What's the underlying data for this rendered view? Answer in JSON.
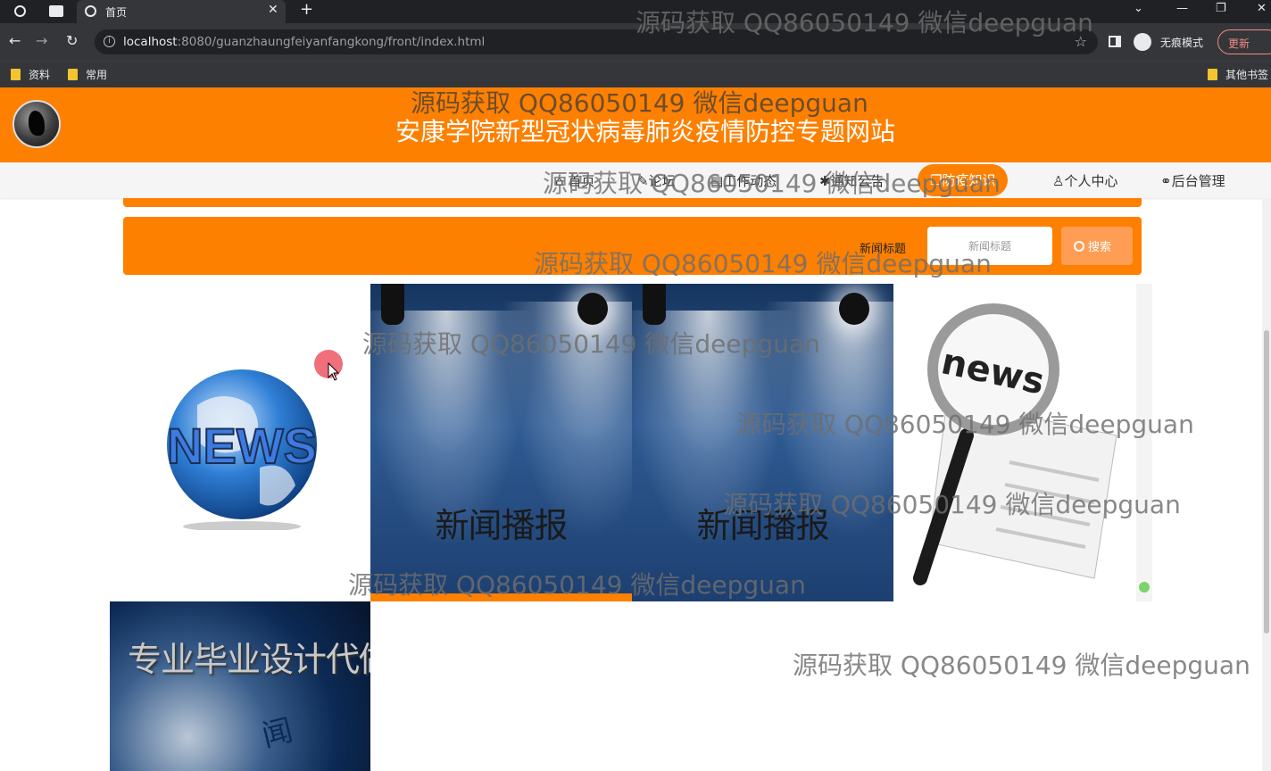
{
  "browser": {
    "tab_title": "首页",
    "url_host": "localhost",
    "url_rest": ":8080/guanzhaungfeiyanfangkong/front/index.html",
    "incognito_label": "无痕模式",
    "update_label": "更新",
    "bookmarks": [
      "资料",
      "常用"
    ],
    "other_bookmarks": "其他书签"
  },
  "site": {
    "title": "安康学院新型冠状病毒肺炎疫情防控专题网站",
    "nav": [
      {
        "label": "首页"
      },
      {
        "label": "论坛"
      },
      {
        "label": "工作动态"
      },
      {
        "label": "通知公告"
      },
      {
        "label": "防疫知识"
      },
      {
        "label": "个人中心"
      },
      {
        "label": "后台管理"
      }
    ],
    "search": {
      "label": "新闻标题",
      "placeholder": "新闻标题",
      "button": "搜索"
    },
    "gallery": {
      "globe_text": "NEWS",
      "spotlight_caption": "新闻播报",
      "magnifier_text": "news",
      "tv_text": "专业毕业设计代做",
      "tv_sub": "闻"
    }
  },
  "watermark": "源码获取 QQ86050149 微信deepguan",
  "colors": {
    "brand": "#fe8000",
    "chrome_dark": "#202124",
    "chrome_toolbar": "#35363a"
  }
}
